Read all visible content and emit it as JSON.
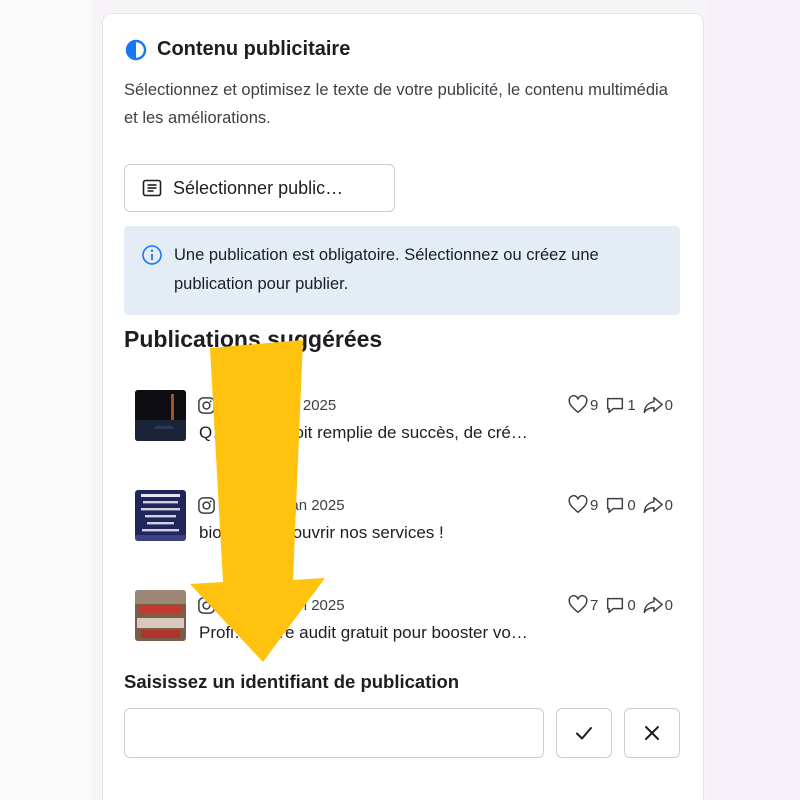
{
  "section": {
    "title": "Contenu publicitaire",
    "description": "Sélectionnez et optimisez le texte de votre publicité, le contenu multimédia et les améliorations.",
    "icon": "half-circle-icon"
  },
  "select_button": {
    "label": "Sélectionner public…",
    "icon": "document-list-icon"
  },
  "info_box": {
    "text": "Une publication est obligatoire. Sélectionnez ou créez une publication pour publier.",
    "icon": "info-icon"
  },
  "suggested": {
    "title": "Publications suggérées",
    "posts": [
      {
        "meta": "Reel · 3 jan 2025",
        "text": "Q… année soit remplie de succès, de cré…",
        "likes": "9",
        "comments": "1",
        "shares": "0"
      },
      {
        "meta": "Reel · 24 jan 2025",
        "text": "bio pour découvrir nos services !",
        "likes": "9",
        "comments": "0",
        "shares": "0"
      },
      {
        "meta": "Reel · 28 jan 2025",
        "text": "Profi… notre audit gratuit pour booster vo…",
        "likes": "7",
        "comments": "0",
        "shares": "0"
      }
    ]
  },
  "post_id": {
    "label": "Saisissez un identifiant de publication",
    "value": "",
    "placeholder": ""
  },
  "colors": {
    "accent": "#1877f2",
    "arrow": "#ffc20e",
    "info_bg": "#e4edf6"
  }
}
